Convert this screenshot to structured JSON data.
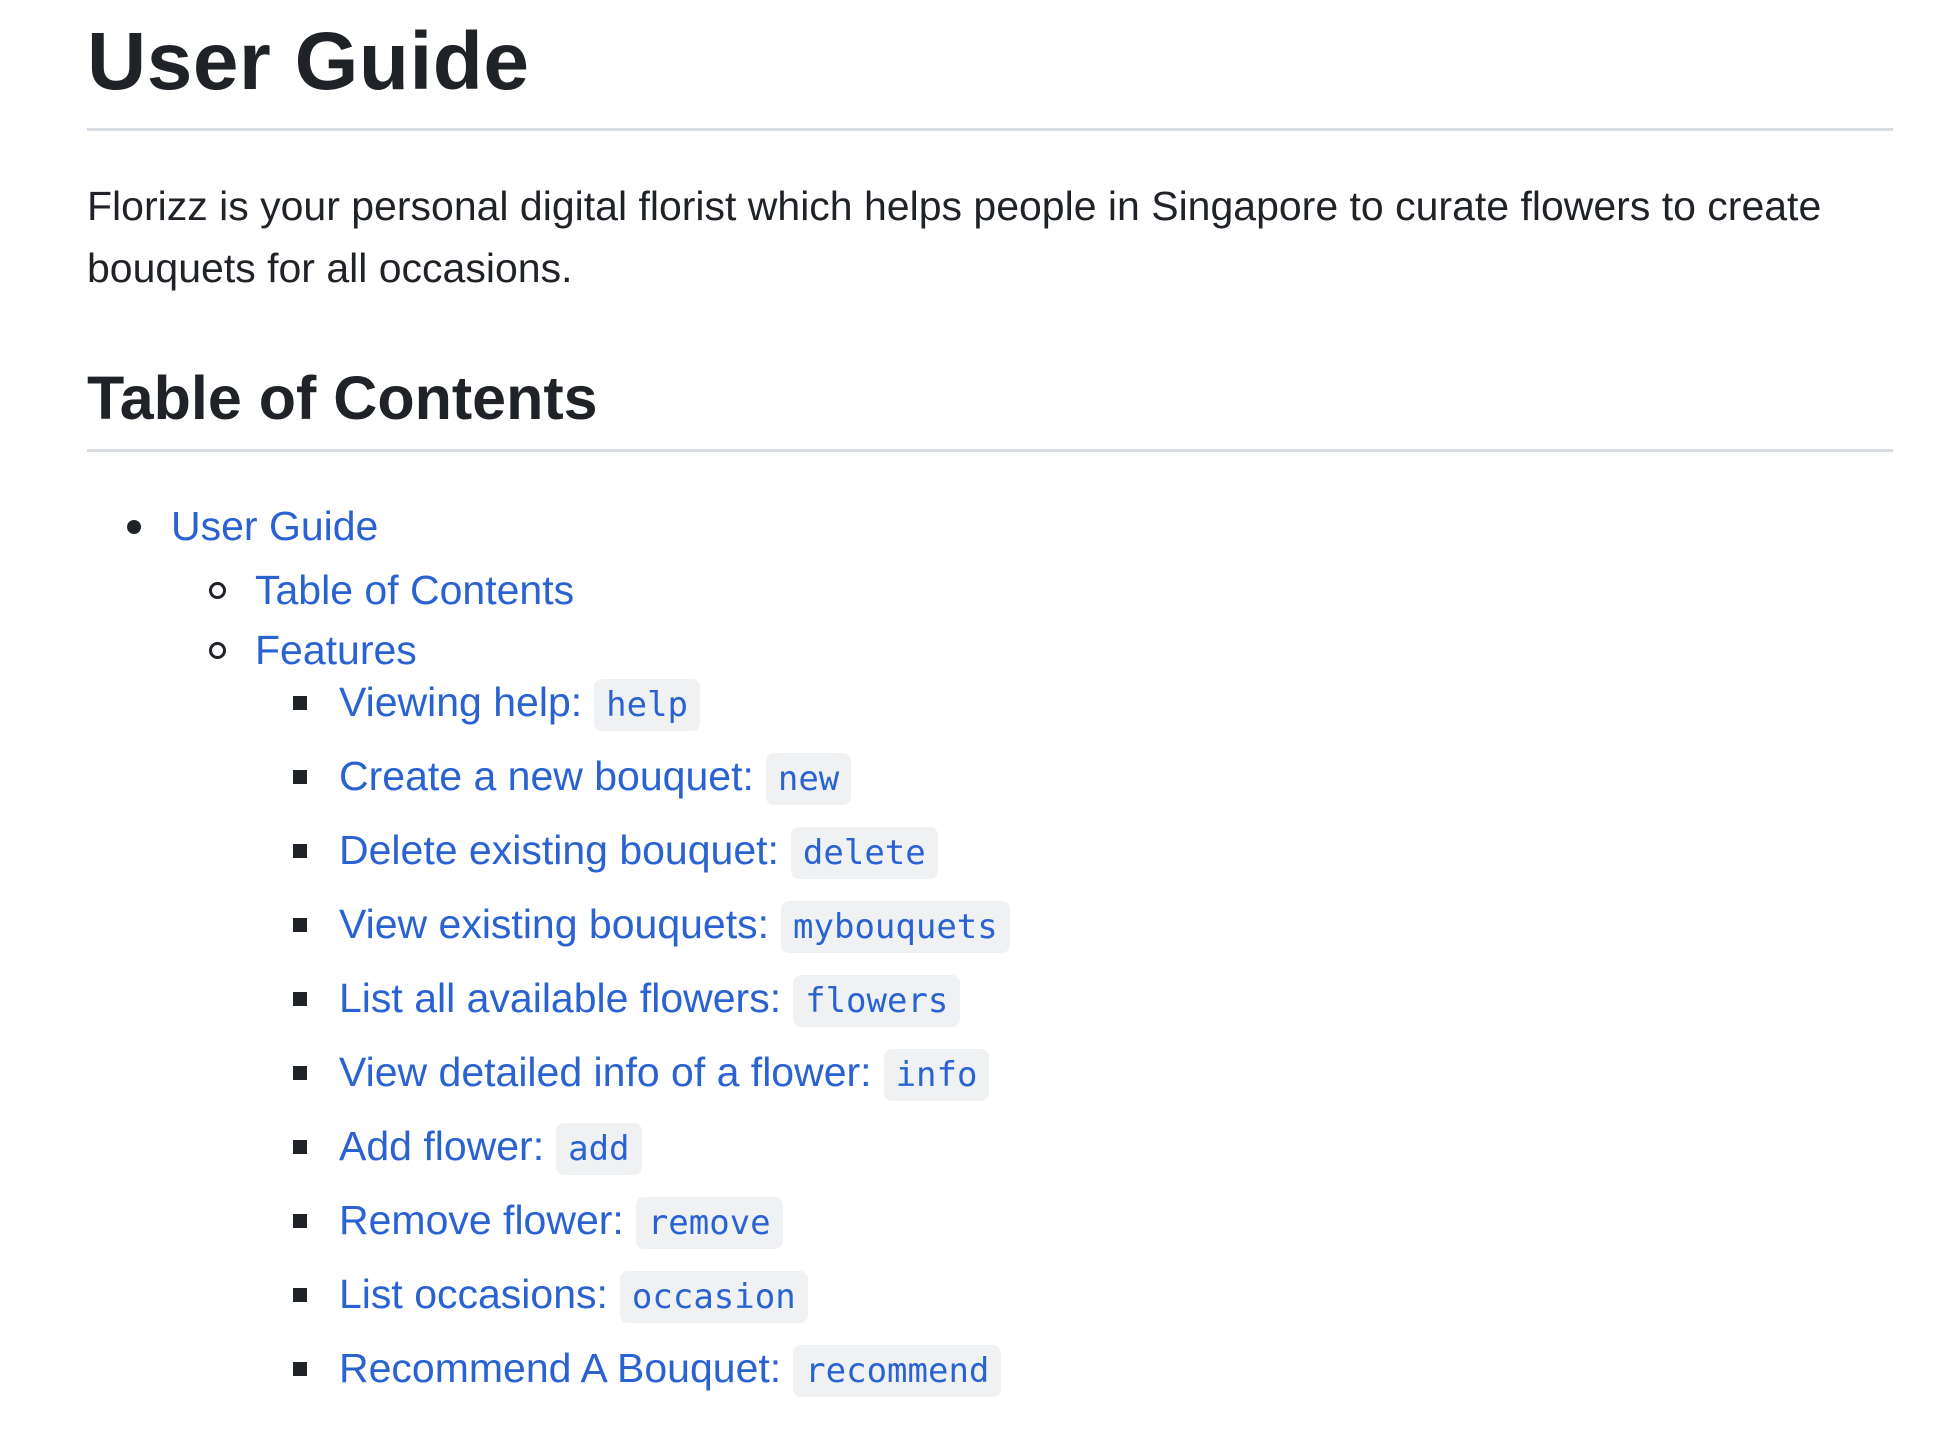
{
  "title": "User Guide",
  "intro": "Florizz is your personal digital florist which helps people in Singapore to curate flowers to create bouquets for all occasions.",
  "toc": {
    "heading": "Table of Contents",
    "level1": "User Guide",
    "level2": [
      "Table of Contents",
      "Features"
    ],
    "features": [
      {
        "label": "Viewing help:",
        "cmd": "help"
      },
      {
        "label": "Create a new bouquet:",
        "cmd": "new"
      },
      {
        "label": "Delete existing bouquet:",
        "cmd": "delete"
      },
      {
        "label": "View existing bouquets:",
        "cmd": "mybouquets"
      },
      {
        "label": "List all available flowers:",
        "cmd": "flowers"
      },
      {
        "label": "View detailed info of a flower:",
        "cmd": "info"
      },
      {
        "label": "Add flower:",
        "cmd": "add"
      },
      {
        "label": "Remove flower:",
        "cmd": "remove"
      },
      {
        "label": "List occasions:",
        "cmd": "occasion"
      },
      {
        "label": "Recommend A Bouquet:",
        "cmd": "recommend"
      }
    ]
  },
  "colors": {
    "link": "#2a62d2",
    "text": "#1f2328",
    "rule": "#d8dee4",
    "code_bg": "#eff1f3"
  }
}
